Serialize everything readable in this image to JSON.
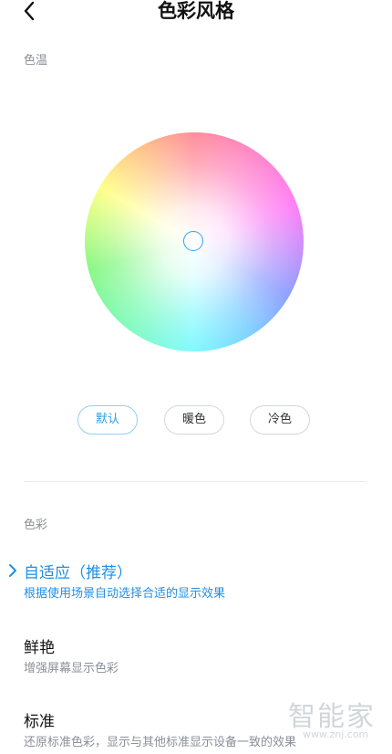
{
  "header": {
    "title": "色彩风格",
    "back_icon": "chevron-left-icon"
  },
  "temperature": {
    "label": "色温",
    "presets": [
      {
        "label": "默认",
        "active": true
      },
      {
        "label": "暖色",
        "active": false
      },
      {
        "label": "冷色",
        "active": false
      }
    ]
  },
  "color": {
    "label": "色彩",
    "options": [
      {
        "title": "自适应（推荐）",
        "desc": "根据使用场景自动选择合适的显示效果",
        "selected": true
      },
      {
        "title": "鲜艳",
        "desc": "增强屏幕显示色彩",
        "selected": false
      },
      {
        "title": "标准",
        "desc": "还原标准色彩，显示与其他标准显示设备一致的效果",
        "selected": false
      }
    ]
  },
  "colors": {
    "accent": "#1e8fe6",
    "secondary_text": "#8a8f99"
  },
  "watermark": {
    "text": "智能家",
    "sub": "www.znj.com"
  }
}
